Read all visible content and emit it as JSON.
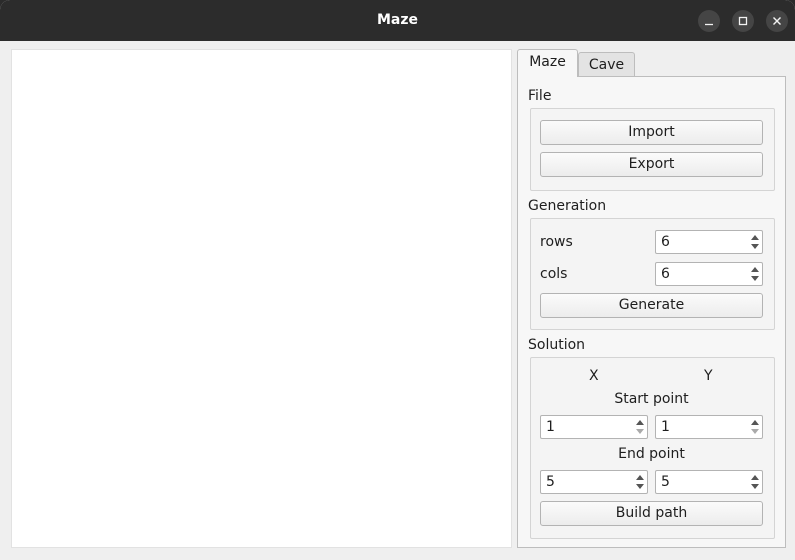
{
  "window": {
    "title": "Maze"
  },
  "tabs": [
    {
      "label": "Maze",
      "active": true
    },
    {
      "label": "Cave",
      "active": false
    }
  ],
  "file": {
    "label": "File",
    "import_label": "Import",
    "export_label": "Export"
  },
  "generation": {
    "label": "Generation",
    "rows_label": "rows",
    "rows_value": "6",
    "cols_label": "cols",
    "cols_value": "6",
    "generate_label": "Generate"
  },
  "solution": {
    "label": "Solution",
    "x_label": "X",
    "y_label": "Y",
    "start_label": "Start point",
    "start_x": "1",
    "start_y": "1",
    "end_label": "End point",
    "end_x": "5",
    "end_y": "5",
    "build_label": "Build path"
  },
  "colors": {
    "titlebar": "#2c2c2c",
    "panel": "#f7f7f7",
    "canvas": "#ffffff"
  }
}
